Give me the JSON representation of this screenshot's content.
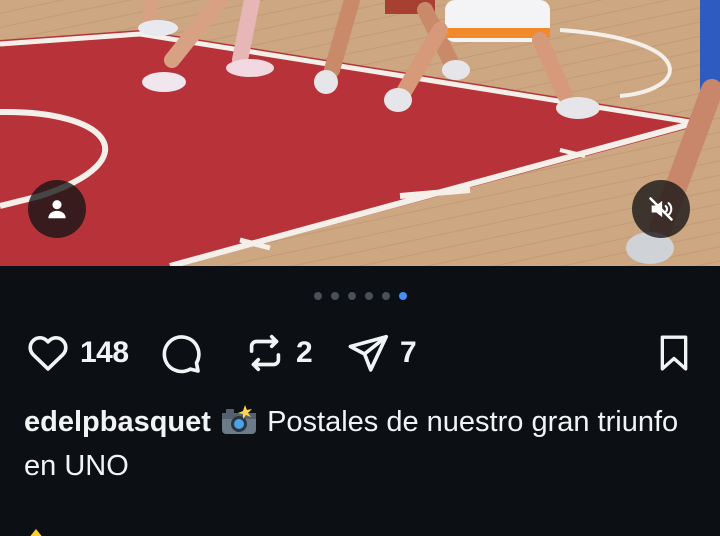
{
  "post": {
    "media": {
      "slide_count": 6,
      "active_slide": 6,
      "overlay_icons": [
        "person-icon",
        "muted-speaker-icon"
      ]
    },
    "actions": {
      "likes": "148",
      "reposts": "2",
      "shares": "7"
    },
    "caption": {
      "username": "edelpbasquet",
      "emoji": "camera-flash",
      "text": "Postales de nuestro gran triunfo en UNO"
    },
    "colors": {
      "background": "#0c0f14",
      "text": "#f2f3f5",
      "active_dot": "#4a8df5",
      "inactive_dot": "#4a4f58"
    }
  }
}
